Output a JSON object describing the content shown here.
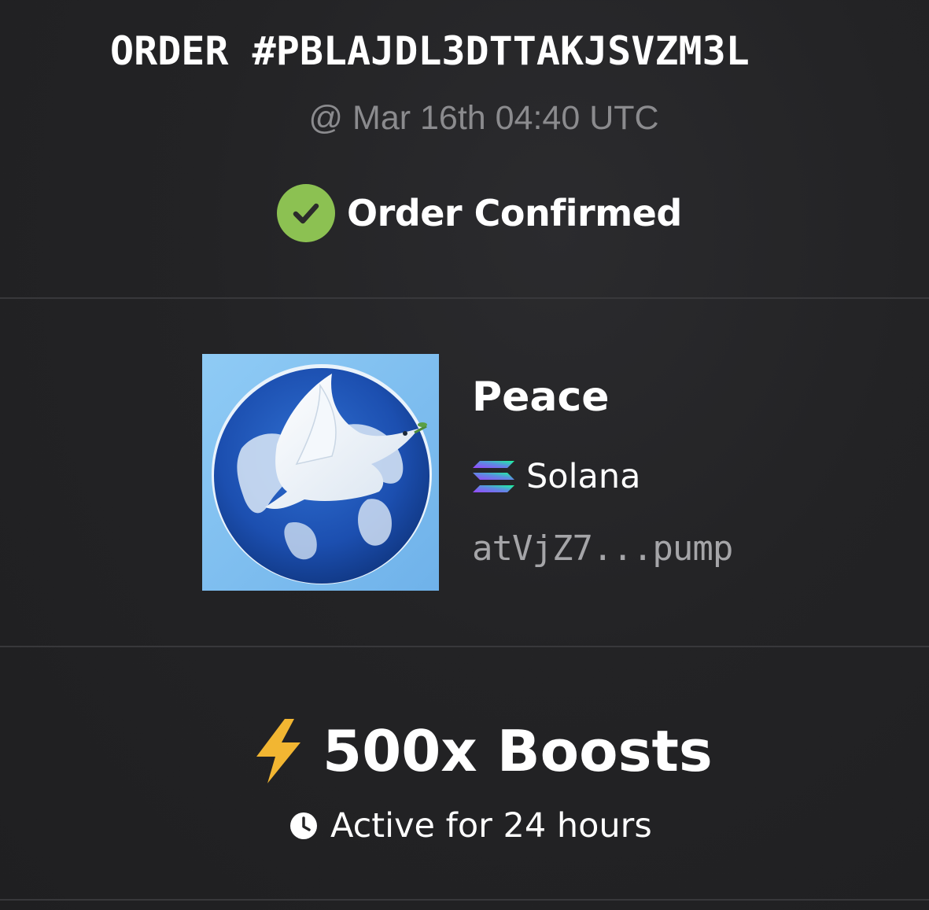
{
  "order": {
    "title": "ORDER #PBLAJDL3DTTAKJSVZM3L",
    "timestamp": "@ Mar 16th 04:40 UTC",
    "status": "Order Confirmed",
    "status_icon": "check-circle-icon",
    "status_color": "#8cc152"
  },
  "token": {
    "name": "Peace",
    "chain": "Solana",
    "chain_icon": "solana-icon",
    "address": "atVjZ7...pump",
    "image": "dove-over-globe-logo"
  },
  "boost": {
    "label": "500x Boosts",
    "icon": "lightning-bolt-icon",
    "icon_color": "#f2b632",
    "duration": "Active for 24 hours",
    "duration_icon": "clock-icon"
  },
  "colors": {
    "background": "#232325",
    "divider": "#38383b",
    "muted_text": "#8b8b8e"
  }
}
